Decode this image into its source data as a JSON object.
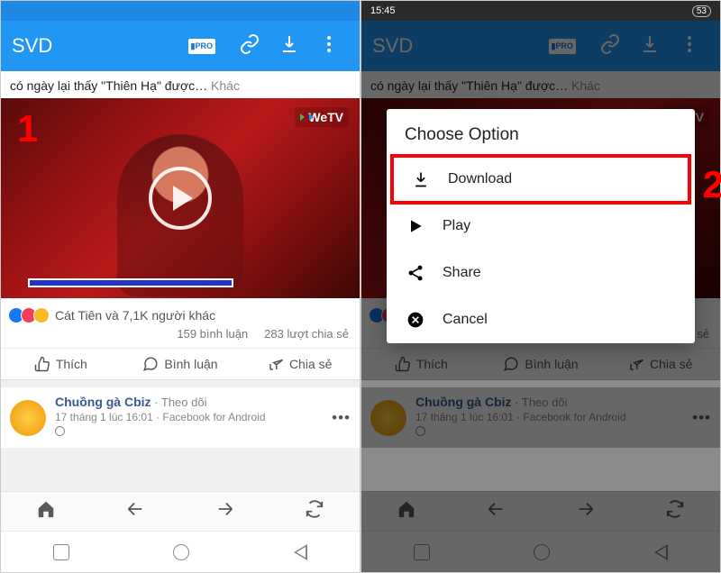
{
  "status": {
    "time": "15:45",
    "battery": "53"
  },
  "appbar": {
    "title": "SVD",
    "pro": "PRO"
  },
  "caption": {
    "text": "có ngày lại thấy \"Thiên Hạ\" được…",
    "more": "Khác"
  },
  "video": {
    "watermark": "WeTV"
  },
  "annotations": {
    "step1": "1",
    "step2": "2"
  },
  "reactions": {
    "text": "Cát Tiên và 7,1K người khác",
    "comments": "159 bình luận",
    "shares": "283 lượt chia sẻ"
  },
  "actions": {
    "like": "Thích",
    "comment": "Bình luận",
    "share": "Chia sẻ"
  },
  "post": {
    "name": "Chuồng gà Cbiz",
    "follow": "Theo dõi",
    "sep": " · ",
    "time": "17 tháng 1 lúc 16:01 · Facebook for Android"
  },
  "dialog": {
    "title": "Choose Option",
    "download": "Download",
    "play": "Play",
    "share": "Share",
    "cancel": "Cancel"
  }
}
